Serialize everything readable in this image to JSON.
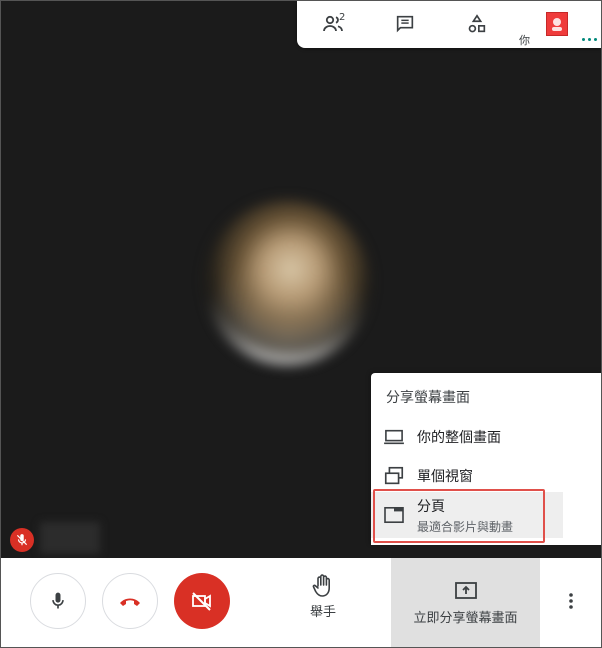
{
  "top_toolbar": {
    "participants_count": "2",
    "self_label": "你"
  },
  "share_menu": {
    "title": "分享螢幕畫面",
    "items": [
      {
        "label": "你的整個畫面",
        "icon": "laptop-icon"
      },
      {
        "label": "單個視窗",
        "icon": "window-icon"
      },
      {
        "label": "分頁",
        "sublabel": "最適合影片與動畫",
        "icon": "browser-tab-icon"
      }
    ]
  },
  "bottom_bar": {
    "raise_hand_label": "舉手",
    "present_now_label": "立即分享螢幕畫面"
  },
  "colors": {
    "danger": "#d93025",
    "stage_bg": "#1b1b1b",
    "highlight": "#e0504a",
    "accent_green": "#00897b"
  }
}
